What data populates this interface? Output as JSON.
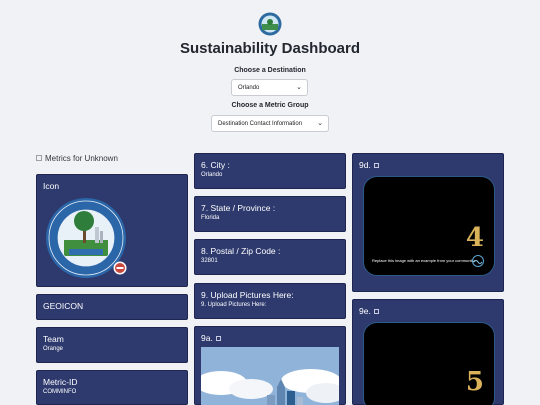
{
  "header": {
    "title": "Sustainability Dashboard",
    "destination_label": "Choose a Destination",
    "destination_value": "Orlando",
    "metric_label": "Choose a Metric Group",
    "metric_value": "Destination Contact Information"
  },
  "left": {
    "unknown_label": "Metrics for Unknown",
    "icon_card": {
      "title": "Icon",
      "seal_text_top": "CITY OF ORLANDO FLORIDA",
      "seal_text_bottom": "THE CITY BEAUTIFUL"
    },
    "geoicon": {
      "title": "GEOICON"
    },
    "team": {
      "title": "Team",
      "value": "Orange"
    },
    "metric_id": {
      "title": "Metric-ID",
      "value": "COMMINFO"
    }
  },
  "middle": {
    "city": {
      "title": "6. City :",
      "value": "Orlando"
    },
    "state": {
      "title": "7. State / Province :",
      "value": "Florida"
    },
    "postal": {
      "title": "8. Postal / Zip Code :",
      "value": "32801"
    },
    "upload": {
      "title": "9. Upload Pictures Here:",
      "value": "9. Upload Pictures Here:"
    },
    "pic9a": {
      "title": "9a."
    }
  },
  "right": {
    "pic9d": {
      "title": "9d.",
      "number": "4",
      "caption": "Replace this image with an example from your community"
    },
    "pic9e": {
      "title": "9e.",
      "number": "5"
    }
  }
}
